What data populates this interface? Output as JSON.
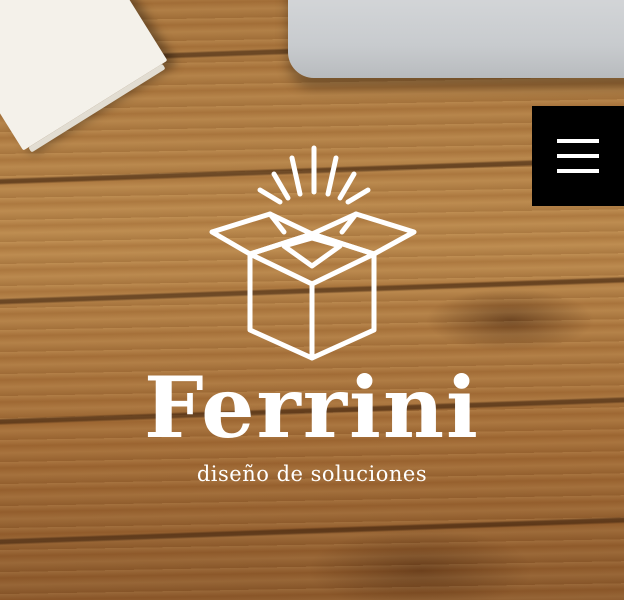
{
  "brand": {
    "name": "Ferrini",
    "tagline": "diseño de soluciones",
    "logo_icon": "open-box-icon"
  },
  "menu": {
    "icon": "hamburger-menu-icon"
  },
  "colors": {
    "logo": "#ffffff",
    "menu_background": "#000000",
    "background": "#b07a43"
  }
}
